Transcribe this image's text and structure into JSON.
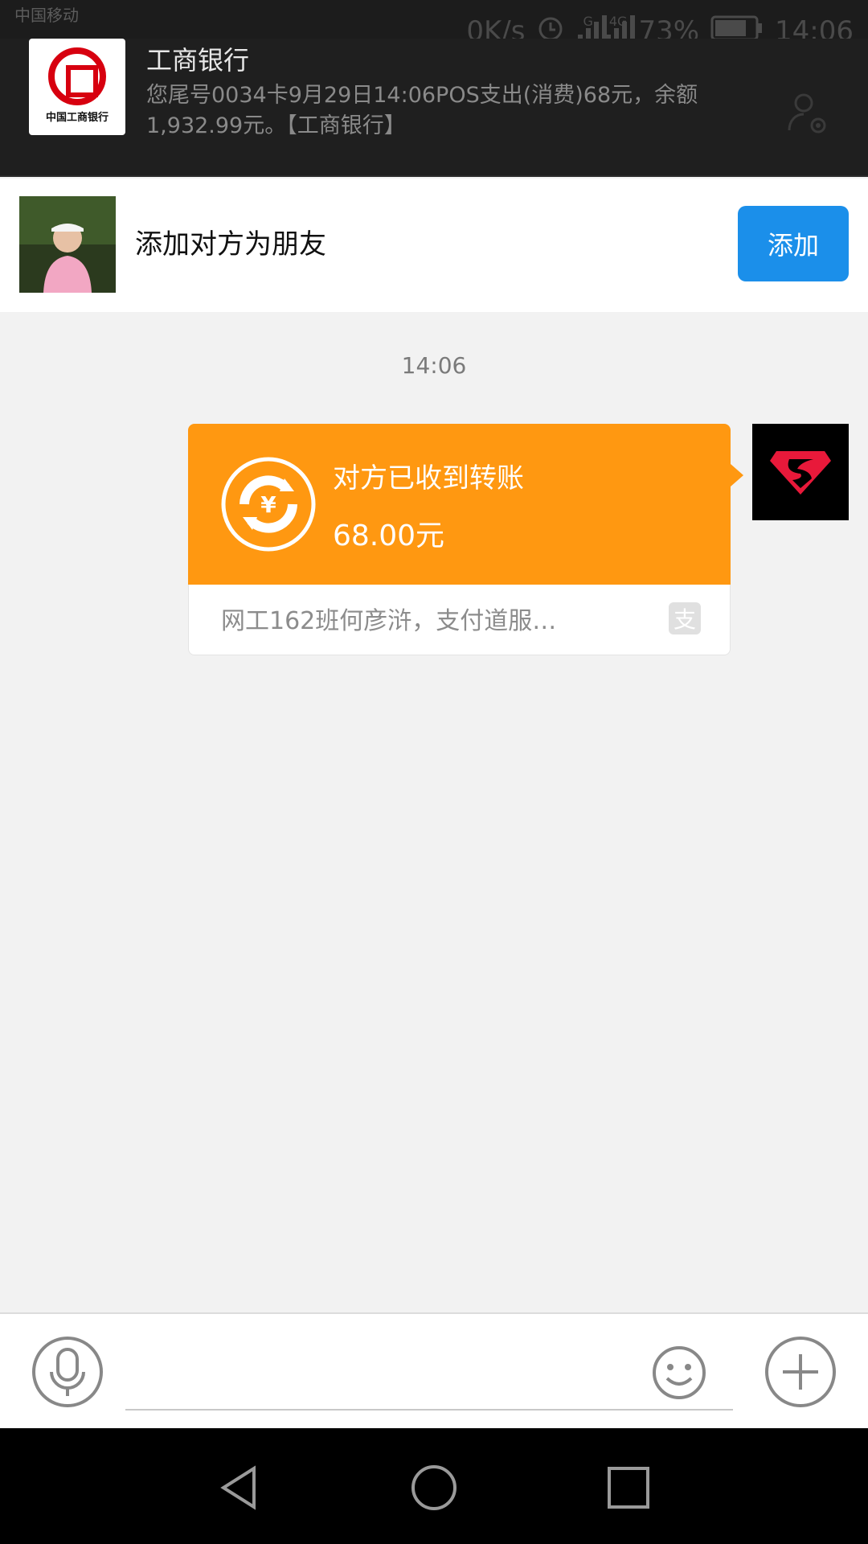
{
  "status_bar": {
    "carrier": "中国移动",
    "speed": "0K/s",
    "signal_labels": [
      "G",
      "4G"
    ],
    "battery": "73%",
    "time": "14:06"
  },
  "notification": {
    "logo_text": "中国工商银行",
    "title": "工商银行",
    "body": "您尾号0034卡9月29日14:06POS支出(消费)68元，余额1,932.99元。【工商银行】"
  },
  "add_friend": {
    "label": "添加对方为朋友",
    "button": "添加"
  },
  "chat": {
    "timestamp": "14:06",
    "transfer": {
      "status": "对方已收到转账",
      "amount": "68.00元",
      "note": "网工162班何彦浒，支付道服…",
      "badge": "支"
    }
  },
  "colors": {
    "accent_blue": "#1b8fea",
    "transfer_orange": "#ff9811",
    "bank_red": "#d7000f"
  },
  "icons": {
    "notif_action": "contact-settings-icon",
    "transfer": "currency-exchange-icon",
    "mic": "microphone-icon",
    "emoji": "smiley-icon",
    "plus": "plus-icon",
    "nav": [
      "back-icon",
      "home-icon",
      "recents-icon"
    ]
  }
}
